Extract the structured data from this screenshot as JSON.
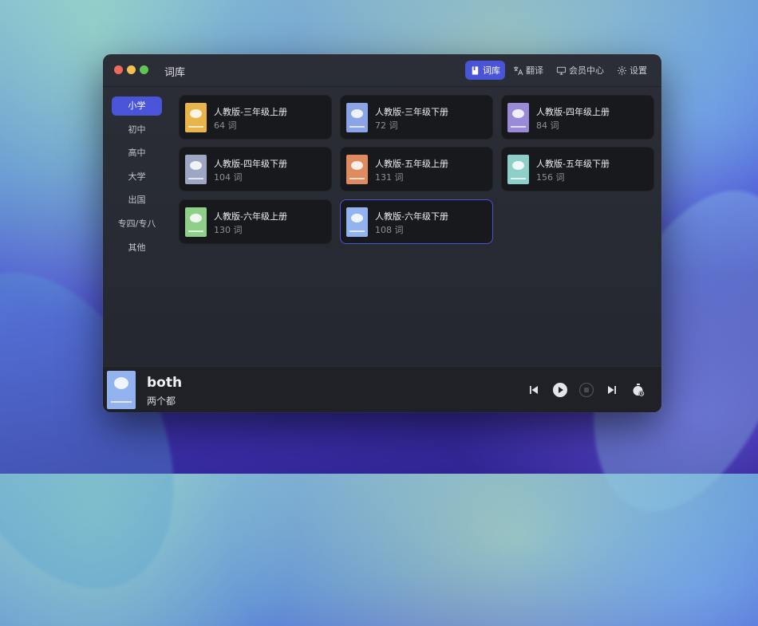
{
  "window": {
    "title": "词库"
  },
  "nav": [
    {
      "label": "词库",
      "icon": "book-icon",
      "active": true
    },
    {
      "label": "翻译",
      "icon": "translate-icon",
      "active": false
    },
    {
      "label": "会员中心",
      "icon": "monitor-icon",
      "active": false
    },
    {
      "label": "设置",
      "icon": "gear-icon",
      "active": false
    }
  ],
  "sidebar": {
    "items": [
      {
        "label": "小学",
        "active": true
      },
      {
        "label": "初中",
        "active": false
      },
      {
        "label": "高中",
        "active": false
      },
      {
        "label": "大学",
        "active": false
      },
      {
        "label": "出国",
        "active": false
      },
      {
        "label": "专四/专八",
        "active": false
      },
      {
        "label": "其他",
        "active": false
      }
    ]
  },
  "books": [
    {
      "title": "人教版-三年级上册",
      "count": "64 词",
      "cover_color": "#e9b44c",
      "selected": false
    },
    {
      "title": "人教版-三年级下册",
      "count": "72 词",
      "cover_color": "#8aa4e6",
      "selected": false
    },
    {
      "title": "人教版-四年级上册",
      "count": "84 词",
      "cover_color": "#9a8ad8",
      "selected": false
    },
    {
      "title": "人教版-四年级下册",
      "count": "104 词",
      "cover_color": "#9da7c4",
      "selected": false
    },
    {
      "title": "人教版-五年级上册",
      "count": "131 词",
      "cover_color": "#e08a60",
      "selected": false
    },
    {
      "title": "人教版-五年级下册",
      "count": "156 词",
      "cover_color": "#8fcfca",
      "selected": false
    },
    {
      "title": "人教版-六年级上册",
      "count": "130 词",
      "cover_color": "#8fcf8a",
      "selected": false
    },
    {
      "title": "人教版-六年级下册",
      "count": "108 词",
      "cover_color": "#93b2f0",
      "selected": true
    }
  ],
  "player": {
    "word": "both",
    "meaning": "两个都",
    "cover_color": "#93b2f0",
    "controls": [
      "previous-icon",
      "play-icon",
      "stop-icon",
      "next-icon",
      "timer-icon"
    ]
  },
  "colors": {
    "accent": "#4a54d9",
    "traffic_red": "#ec6a5e",
    "traffic_yellow": "#f4bf4f",
    "traffic_green": "#61c554"
  }
}
